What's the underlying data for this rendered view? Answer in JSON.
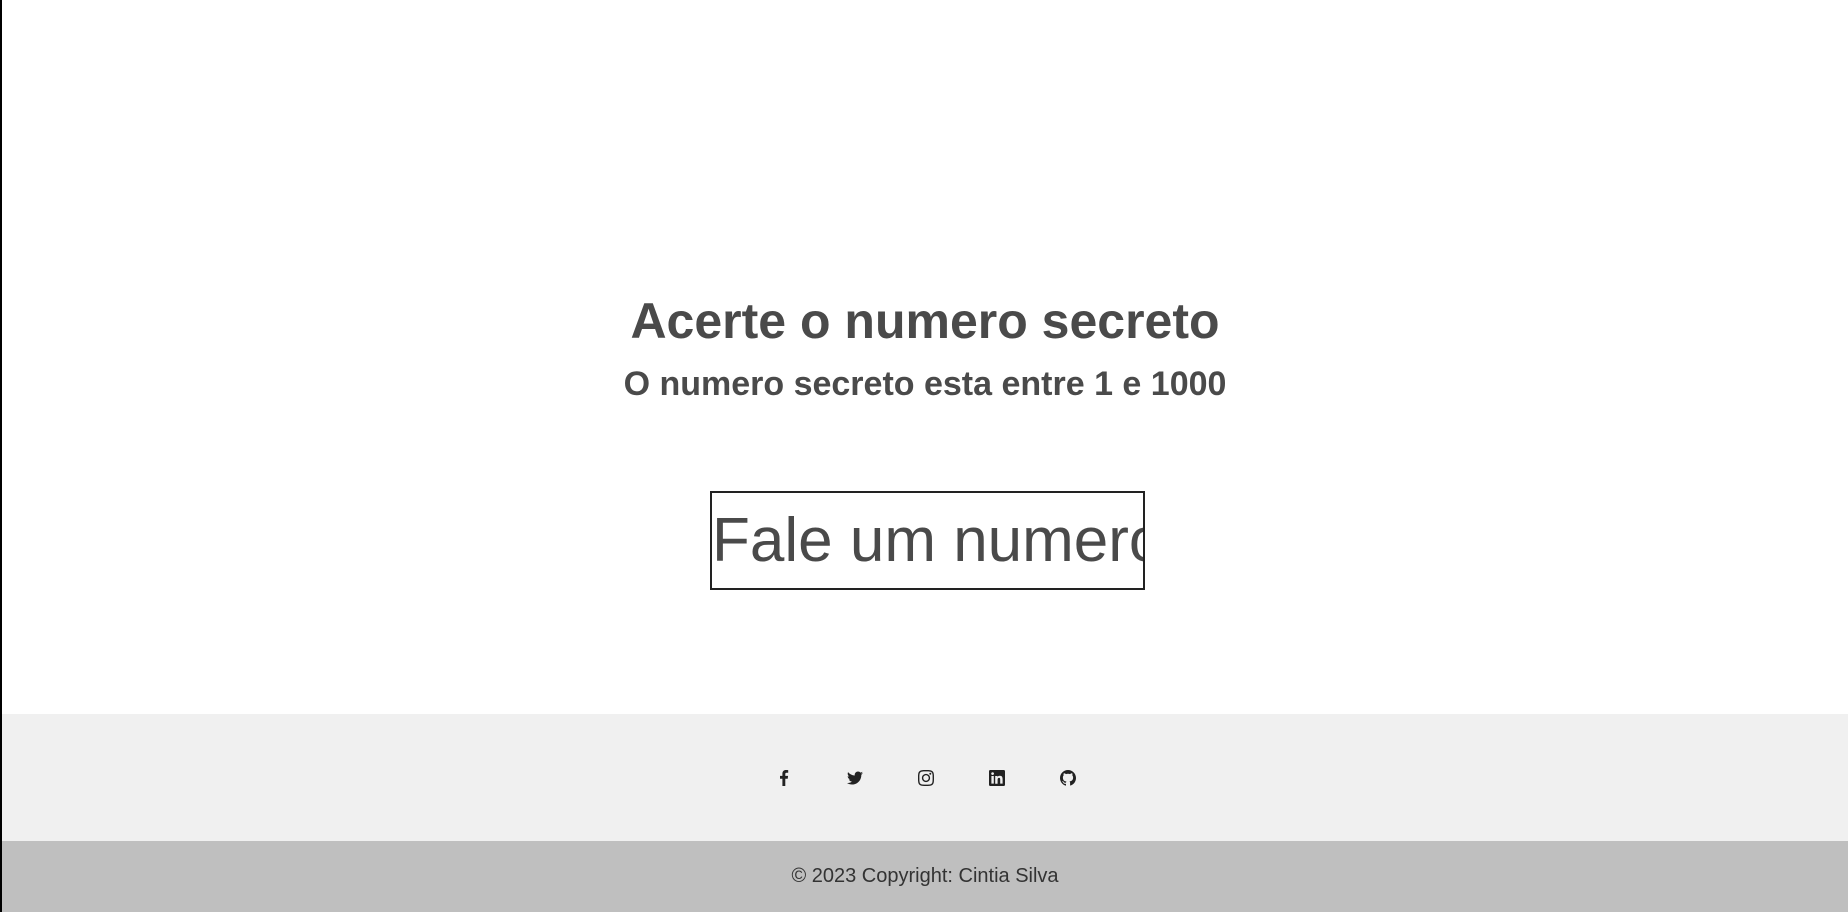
{
  "game": {
    "title": "Acerte o numero secreto",
    "subtitle": "O numero secreto esta entre 1 e 1000",
    "input_placeholder": "Fale um numero"
  },
  "footer": {
    "social_icons": [
      "facebook-icon",
      "twitter-icon",
      "instagram-icon",
      "linkedin-icon",
      "github-icon"
    ],
    "copyright": "© 2023 Copyright: Cintia Silva"
  },
  "colors": {
    "text": "#4a4a4a",
    "social_bar_bg": "#f0f0f0",
    "copyright_bar_bg": "#bfbfbf"
  }
}
